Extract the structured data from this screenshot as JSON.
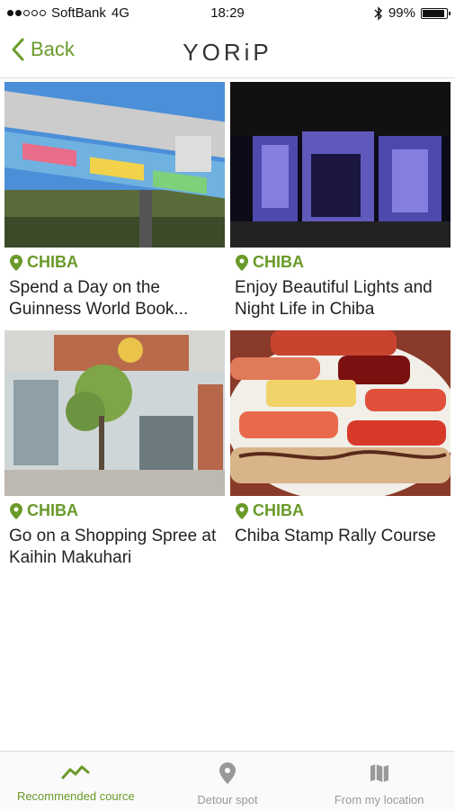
{
  "status_bar": {
    "carrier": "SoftBank",
    "network": "4G",
    "time": "18:29",
    "battery": "99%",
    "battery_level": 0.99
  },
  "nav": {
    "back_label": "Back",
    "logo": "YORiP"
  },
  "cards": [
    {
      "location": "CHIBA",
      "title": "Spend a Day on the Guinness World Book..."
    },
    {
      "location": "CHIBA",
      "title": "Enjoy Beautiful Lights and Night Life in Chiba"
    },
    {
      "location": "CHIBA",
      "title": "Go on a Shopping Spree at Kaihin Makuhari"
    },
    {
      "location": "CHIBA",
      "title": "Chiba Stamp Rally Course"
    }
  ],
  "tabs": [
    {
      "label": "Recommended cource",
      "icon": "trend-icon",
      "active": true
    },
    {
      "label": "Detour spot",
      "icon": "pin-icon",
      "active": false
    },
    {
      "label": "From my location",
      "icon": "map-icon",
      "active": false
    }
  ],
  "colors": {
    "accent": "#6a9a2a",
    "inactive": "#999999"
  }
}
